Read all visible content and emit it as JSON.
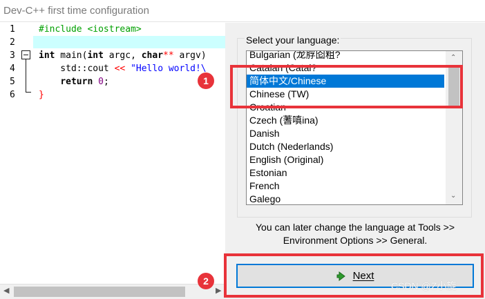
{
  "window": {
    "title": "Dev-C++ first time configuration"
  },
  "editor": {
    "line_numbers": [
      "1",
      "2",
      "3",
      "4",
      "5",
      "6"
    ],
    "lines": [
      {
        "tokens": [
          {
            "t": "#include <iostream>",
            "c": "pp"
          }
        ]
      },
      {
        "tokens": []
      },
      {
        "tokens": [
          {
            "t": "int",
            "c": "kw"
          },
          {
            "t": " main(",
            "c": ""
          },
          {
            "t": "int",
            "c": "kw"
          },
          {
            "t": " argc, ",
            "c": ""
          },
          {
            "t": "char",
            "c": "kw"
          },
          {
            "t": "**",
            "c": "op"
          },
          {
            "t": " argv)",
            "c": ""
          }
        ]
      },
      {
        "tokens": [
          {
            "t": "    std::cout ",
            "c": ""
          },
          {
            "t": "<<",
            "c": "op"
          },
          {
            "t": " ",
            "c": ""
          },
          {
            "t": "\"Hello world!\\",
            "c": "str"
          }
        ]
      },
      {
        "tokens": [
          {
            "t": "    ",
            "c": ""
          },
          {
            "t": "return",
            "c": "kw"
          },
          {
            "t": " ",
            "c": ""
          },
          {
            "t": "0",
            "c": "num"
          },
          {
            "t": ";",
            "c": ""
          }
        ]
      },
      {
        "tokens": [
          {
            "t": "}",
            "c": "br"
          }
        ]
      }
    ]
  },
  "language_panel": {
    "label": "Select your language:",
    "items": [
      "Bulgarian (龙脬囵粗?",
      "Catalan (Catal?",
      "简体中文/Chinese",
      "Chinese (TW)",
      "Croatian",
      "Czech (蓍嗔ina)",
      "Danish",
      "Dutch (Nederlands)",
      "English (Original)",
      "Estonian",
      "French",
      "Galego"
    ],
    "selected_index": 2,
    "hint_line1": "You can later change the language at Tools >>",
    "hint_line2": "Environment Options >> General."
  },
  "next_button": {
    "label": "Next"
  },
  "callouts": {
    "one": "1",
    "two": "2"
  },
  "watermark": "CSDN @Z小旋",
  "colors": {
    "accent": "#0078d7",
    "callout": "#e8333a",
    "include": "#00a000",
    "string": "#0000ff"
  }
}
